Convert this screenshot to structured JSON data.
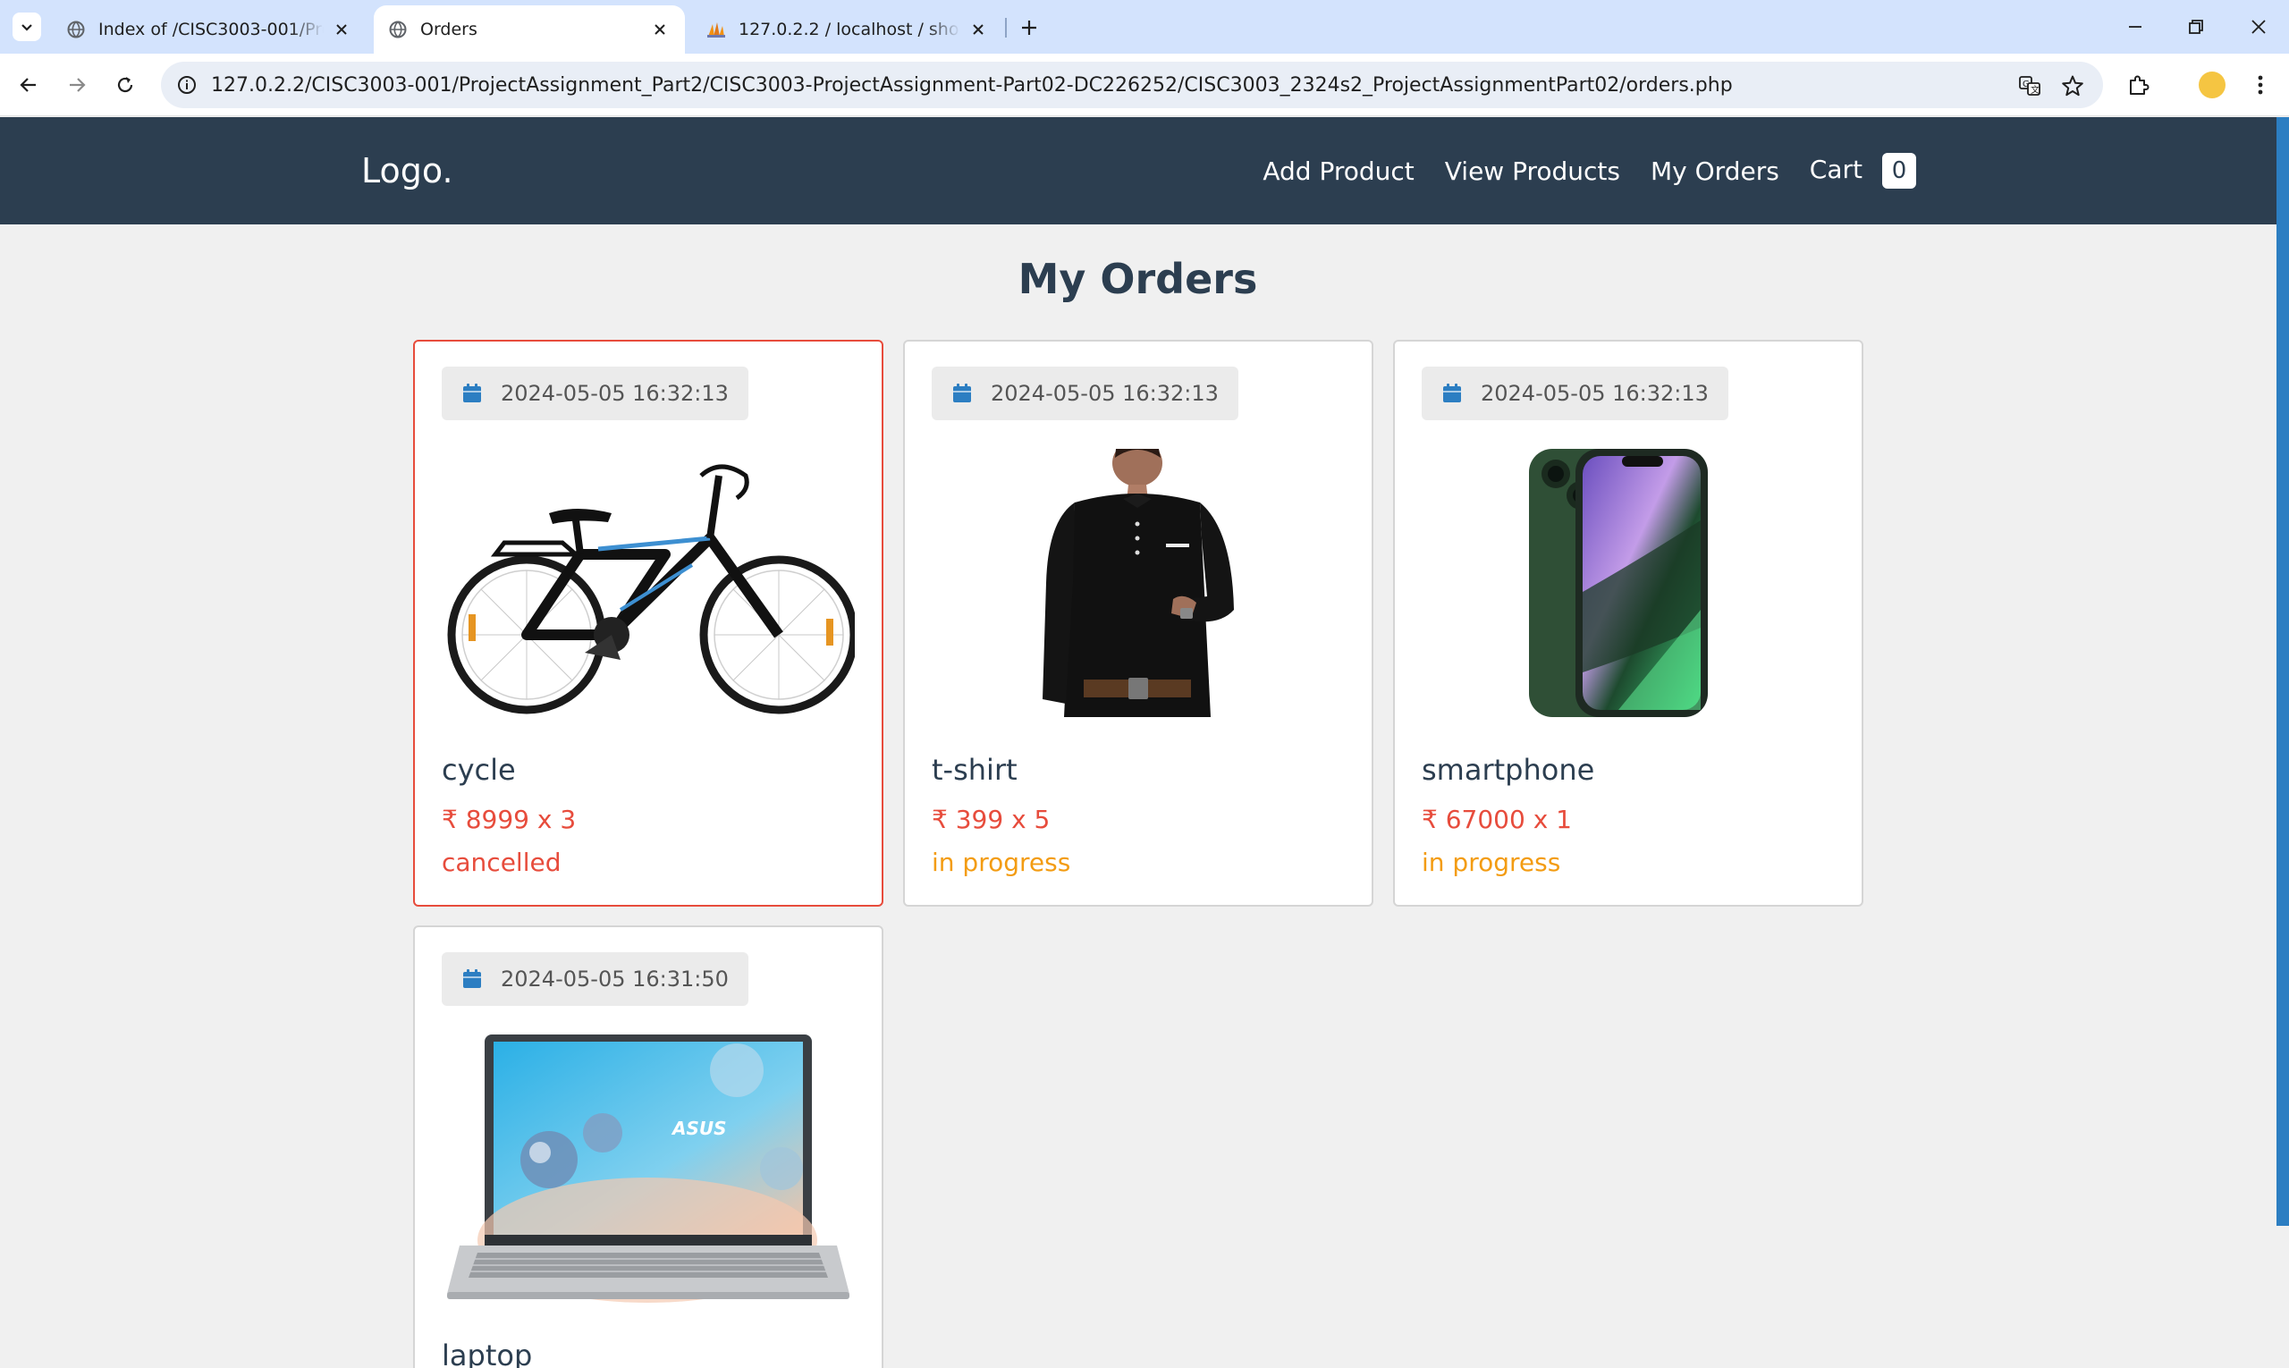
{
  "browser": {
    "tabs": [
      {
        "title": "Index of /CISC3003-001/Proje",
        "active": false
      },
      {
        "title": "Orders",
        "active": true
      },
      {
        "title": "127.0.2.2 / localhost / shop_db",
        "active": false
      }
    ],
    "url": "127.0.2.2/CISC3003-001/ProjectAssignment_Part2/CISC3003-ProjectAssignment-Part02-DC226252/CISC3003_2324s2_ProjectAssignmentPart02/orders.php"
  },
  "navbar": {
    "logo": "Logo.",
    "links": [
      "Add Product",
      "View Products",
      "My Orders"
    ],
    "cart_label": "Cart",
    "cart_count": "0"
  },
  "page": {
    "title": "My Orders",
    "currency_symbol": "₹"
  },
  "orders": [
    {
      "date": "2024-05-05 16:32:13",
      "name": "cycle",
      "price": "8999",
      "qty": "3",
      "price_text": "8999 x 3",
      "status": "cancelled",
      "image": "bicycle"
    },
    {
      "date": "2024-05-05 16:32:13",
      "name": "t-shirt",
      "price": "399",
      "qty": "5",
      "price_text": "399 x 5",
      "status": "in progress",
      "image": "black-shirt"
    },
    {
      "date": "2024-05-05 16:32:13",
      "name": "smartphone",
      "price": "67000",
      "qty": "1",
      "price_text": "67000 x 1",
      "status": "in progress",
      "image": "green-phone"
    },
    {
      "date": "2024-05-05 16:31:50",
      "name": "laptop",
      "price": "",
      "qty": "",
      "price_text": "",
      "status": "",
      "image": "laptop"
    }
  ],
  "colors": {
    "navbar": "#2c3e50",
    "cancelled": "#e74c3c",
    "in_progress": "#f39c12",
    "calendar_icon": "#2c7ec2"
  }
}
